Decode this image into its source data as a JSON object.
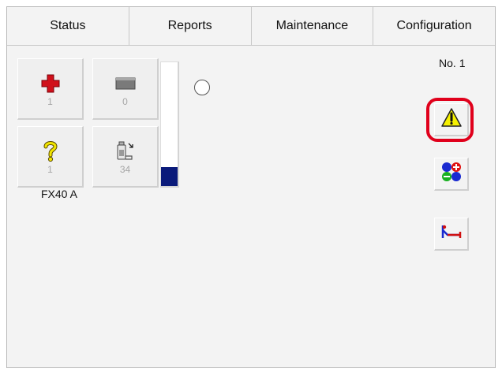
{
  "tabs": [
    {
      "label": "Status"
    },
    {
      "label": "Reports"
    },
    {
      "label": "Maintenance"
    },
    {
      "label": "Configuration"
    }
  ],
  "device": {
    "name": "FX40 A",
    "tiles": [
      {
        "icon": "red-cross-icon",
        "count": "1"
      },
      {
        "icon": "gray-tray-icon",
        "count": "0"
      },
      {
        "icon": "question-mark-icon",
        "count": "1"
      },
      {
        "icon": "reagent-bottle-icon",
        "count": "34"
      }
    ],
    "level_fraction": 0.15
  },
  "header": {
    "number_label": "No.",
    "number_value": "1"
  },
  "side_buttons": [
    {
      "icon": "warning-triangle-icon"
    },
    {
      "icon": "plus-minus-balls-icon"
    },
    {
      "icon": "bed-patient-icon"
    }
  ],
  "colors": {
    "highlight": "#e0001b",
    "gauge_fill": "#0a1a7a"
  }
}
